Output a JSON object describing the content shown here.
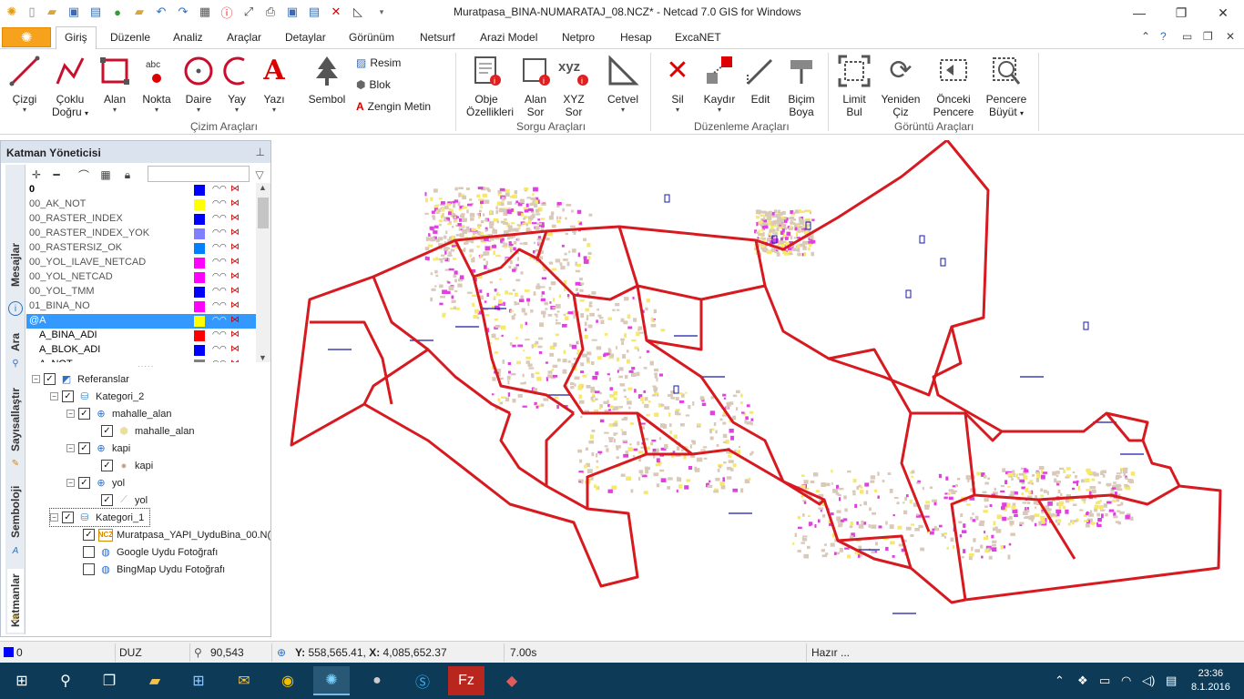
{
  "window": {
    "title": "Muratpasa_BINA-NUMARATAJ_08.NCZ* - Netcad 7.0 GIS for Windows"
  },
  "menu": {
    "tabs": [
      "Giriş",
      "Düzenle",
      "Analiz",
      "Araçlar",
      "Detaylar",
      "Görünüm",
      "Netsurf",
      "Arazi Model",
      "Netpro",
      "Hesap",
      "ExcaNET"
    ],
    "active_tab": "Giriş"
  },
  "ribbon": {
    "draw": {
      "cizgi": "Çizgi",
      "coklu1": "Çoklu",
      "coklu2": "Doğru",
      "alan": "Alan",
      "nokta": "Nokta",
      "daire": "Daire",
      "yay": "Yay",
      "yazi": "Yazı",
      "sembol": "Sembol",
      "resim": "Resim",
      "blok": "Blok",
      "zengin": "Zengin Metin",
      "group": "Çizim Araçları"
    },
    "query": {
      "obje1": "Obje",
      "obje2": "Özellikleri",
      "alan1": "Alan",
      "alan2": "Sor",
      "xyz_icon": "xyz",
      "xyz1": "XYZ",
      "xyz2": "Sor",
      "cetvel": "Cetvel",
      "group": "Sorgu Araçları"
    },
    "edit": {
      "sil": "Sil",
      "kaydir": "Kaydır",
      "edit": "Edit",
      "bicim1": "Biçim",
      "bicim2": "Boya",
      "group": "Düzenleme Araçları"
    },
    "view": {
      "limit1": "Limit",
      "limit2": "Bul",
      "yeniden1": "Yeniden",
      "yeniden2": "Çiz",
      "onceki1": "Önceki",
      "onceki2": "Pencere",
      "pencere1": "Pencere",
      "pencere2": "Büyüt",
      "group": "Görüntü Araçları"
    }
  },
  "panel": {
    "title": "Katman Yöneticisi",
    "side_tabs": [
      "Mesajlar",
      "Ara",
      "Sayısallaştır",
      "Semboloji",
      "Katmanlar"
    ],
    "layers": [
      {
        "name": "0",
        "color": "#0000ff"
      },
      {
        "name": "00_AK_NOT",
        "color": "#ffff00"
      },
      {
        "name": "00_RASTER_INDEX",
        "color": "#0000ff"
      },
      {
        "name": "00_RASTER_INDEX_YOK",
        "color": "#8080ff"
      },
      {
        "name": "00_RASTERSIZ_OK",
        "color": "#0080ff"
      },
      {
        "name": "00_YOL_ILAVE_NETCAD",
        "color": "#ff00ff"
      },
      {
        "name": "00_YOL_NETCAD",
        "color": "#ff00ff"
      },
      {
        "name": "00_YOL_TMM",
        "color": "#0000ff"
      },
      {
        "name": "01_BINA_NO",
        "color": "#ff00ff"
      },
      {
        "name": "@A",
        "color": "#ffff00"
      },
      {
        "name": "A_BINA_ADI",
        "color": "#ff0000"
      },
      {
        "name": "A_BLOK_ADI",
        "color": "#0000ff"
      },
      {
        "name": "A_NOT",
        "color": "#808080"
      }
    ],
    "tree": {
      "referanslar": "Referanslar",
      "kategori2": "Kategori_2",
      "mahalle_alan": "mahalle_alan",
      "kapi": "kapi",
      "yol": "yol",
      "kategori1": "Kategori_1",
      "ncz_icon": "NCZ",
      "muratpasa": "Muratpasa_YAPI_UyduBina_00.N(",
      "google": "Google Uydu Fotoğrafı",
      "bing": "BingMap Uydu Fotoğrafı"
    }
  },
  "status": {
    "layer": "0",
    "mode": "DUZ",
    "zoom": "90,543",
    "y_label": "Y:",
    "y_value": "558,565.41,",
    "x_label": "X:",
    "x_value": "4,085,652.37",
    "time": "7.00s",
    "state": "Hazır ..."
  },
  "taskbar": {
    "time": "23:36",
    "date": "8.1.2016"
  }
}
